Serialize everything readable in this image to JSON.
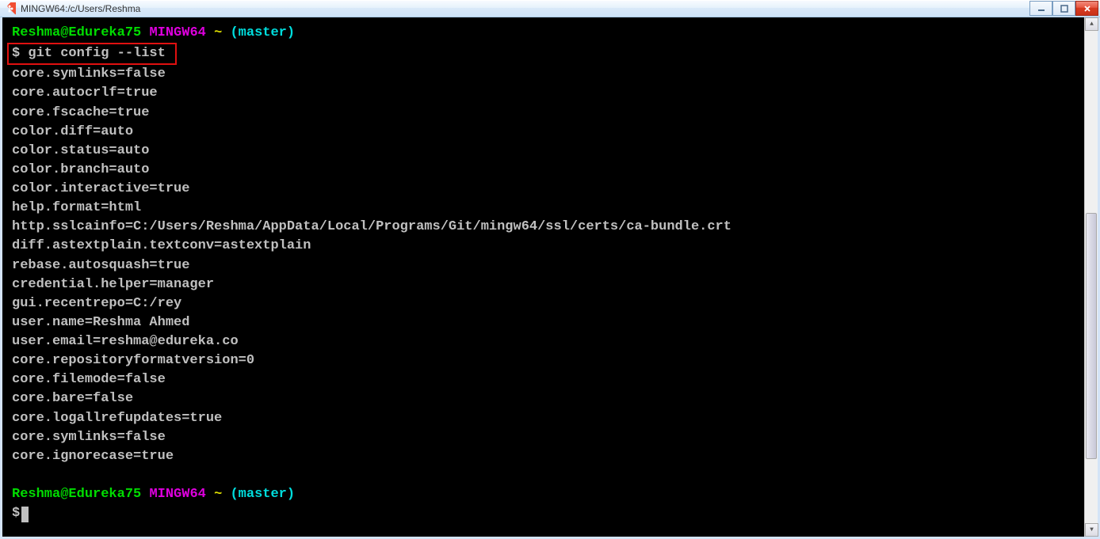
{
  "window": {
    "title": "MINGW64:/c/Users/Reshma"
  },
  "prompt1": {
    "user_host": "Reshma@Edureka75",
    "mingw": "MINGW64",
    "tilde": "~",
    "branch": "(master)",
    "dollar": "$",
    "command": "git config --list"
  },
  "output": [
    "core.symlinks=false",
    "core.autocrlf=true",
    "core.fscache=true",
    "color.diff=auto",
    "color.status=auto",
    "color.branch=auto",
    "color.interactive=true",
    "help.format=html",
    "http.sslcainfo=C:/Users/Reshma/AppData/Local/Programs/Git/mingw64/ssl/certs/ca-bundle.crt",
    "diff.astextplain.textconv=astextplain",
    "rebase.autosquash=true",
    "credential.helper=manager",
    "gui.recentrepo=C:/rey",
    "user.name=Reshma Ahmed",
    "user.email=reshma@edureka.co",
    "core.repositoryformatversion=0",
    "core.filemode=false",
    "core.bare=false",
    "core.logallrefupdates=true",
    "core.symlinks=false",
    "core.ignorecase=true"
  ],
  "prompt2": {
    "user_host": "Reshma@Edureka75",
    "mingw": "MINGW64",
    "tilde": "~",
    "branch": "(master)",
    "dollar": "$"
  }
}
